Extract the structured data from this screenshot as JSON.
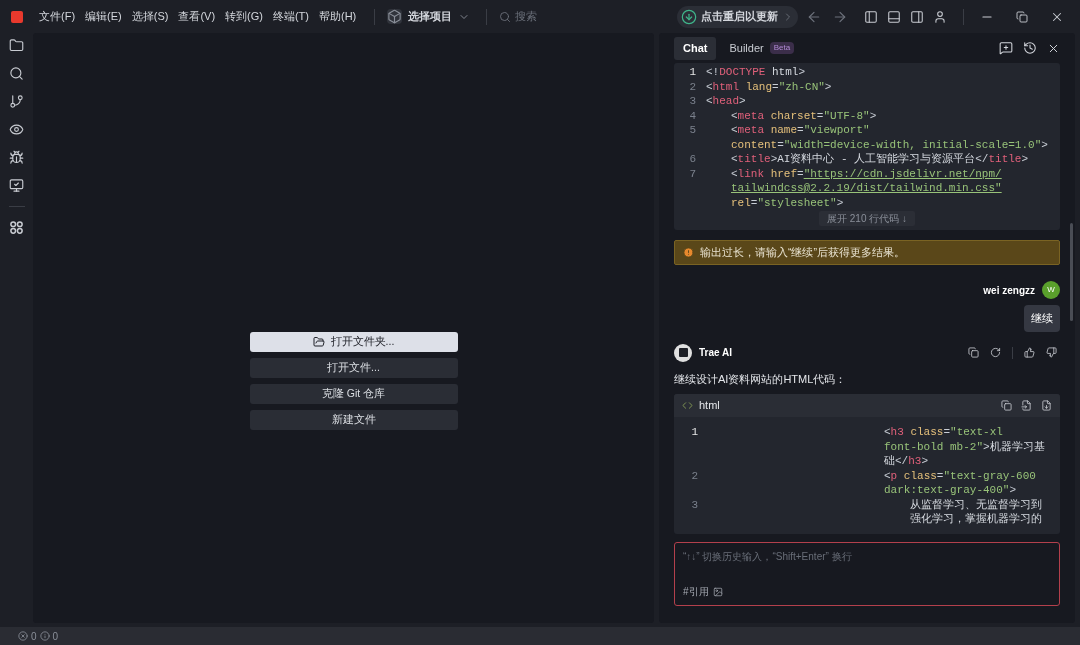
{
  "menu": [
    "文件(F)",
    "编辑(E)",
    "选择(S)",
    "查看(V)",
    "转到(G)",
    "终端(T)",
    "帮助(H)"
  ],
  "project": {
    "label": "选择项目"
  },
  "search": {
    "placeholder": "搜索"
  },
  "update": {
    "label": "点击重启以更新"
  },
  "welcome_actions": [
    {
      "label": "打开文件夹...",
      "primary": true
    },
    {
      "label": "打开文件...",
      "primary": false
    },
    {
      "label": "克隆 Git 仓库",
      "primary": false
    },
    {
      "label": "新建文件",
      "primary": false
    }
  ],
  "chat": {
    "tabs": [
      {
        "label": "Chat",
        "selected": true
      },
      {
        "label": "Builder",
        "badge": "Beta",
        "selected": false
      }
    ],
    "code_block_top": {
      "lines": [
        {
          "number": "1",
          "nested": false,
          "rows": [
            "<!DOCTYPE html>"
          ]
        },
        {
          "number": "2",
          "nested": false,
          "rows": [
            "<html lang=\"zh-CN\">"
          ]
        },
        {
          "number": "3",
          "nested": false,
          "rows": [
            "<head>"
          ]
        },
        {
          "number": "4",
          "nested": true,
          "rows": [
            "<meta charset=\"UTF-8\">"
          ]
        },
        {
          "number": "5",
          "nested": true,
          "rows": [
            "<meta name=\"viewport\"",
            "content=\"width=device-width, initial-scale=1.0\">"
          ]
        },
        {
          "number": "6",
          "nested": true,
          "rows": [
            "<title>AI资料中心 - 人工智能学习与资源平台</title>"
          ]
        },
        {
          "number": "7",
          "nested": true,
          "rows": [
            "<link href=\"https://cdn.jsdelivr.net/npm/",
            "tailwindcss@2.2.19/dist/tailwind.min.css\"",
            "rel=\"stylesheet\">"
          ]
        }
      ],
      "expand": "展开 210 行代码 ↓"
    },
    "warning": "输出过长，请输入“继续”后获得更多结果。",
    "user": {
      "name": "wei zengzz",
      "initial": "W",
      "message": "继续"
    },
    "assistant": {
      "name": "Trae AI",
      "message": "继续设计AI资料网站的HTML代码：",
      "code_block": {
        "language": "html",
        "lines": [
          {
            "number": "1",
            "nested": false,
            "rows": [
              "<h3 class=\"text-xl",
              "font-bold mb-2\">机器学习基",
              "础</h3>"
            ]
          },
          {
            "number": "2",
            "nested": false,
            "rows": [
              "<p class=\"text-gray-600",
              "dark:text-gray-400\">"
            ]
          },
          {
            "number": "3",
            "nested": true,
            "rows": [
              "从监督学习、无监督学习到",
              "强化学习，掌握机器学习的"
            ]
          }
        ]
      }
    },
    "input": {
      "placeholder": "“↑↓” 切换历史输入，“Shift+Enter” 换行",
      "reference": "#引用"
    }
  },
  "status_bar": {
    "errors": "0",
    "warnings": "0"
  }
}
